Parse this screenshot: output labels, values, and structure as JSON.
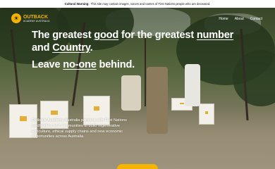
{
  "warning": {
    "label": "Cultural Warning:",
    "text": "This site may contain images, voices and names of First Nations people who are deceased."
  },
  "header": {
    "logo_name": "OUTBACK",
    "logo_sub": "ACADEMY AUSTRALIA",
    "nav": [
      "Home",
      "About",
      "Contact"
    ]
  },
  "hero": {
    "headline_parts": [
      "The greatest ",
      "good",
      " for the greatest ",
      "number",
      " and ",
      "Country",
      "."
    ],
    "subhead_parts": [
      "Leave ",
      "no-one",
      " behind."
    ],
    "blurb": "Outback Academy Australia partners with First Nations landholders and communities to build regenerative agriculture, ethical supply chains and new economic opportunities across Australia."
  },
  "colors": {
    "accent": "#f4b400",
    "warning_bg": "#ffffff"
  },
  "icons": {
    "logo": "sun-icon"
  }
}
